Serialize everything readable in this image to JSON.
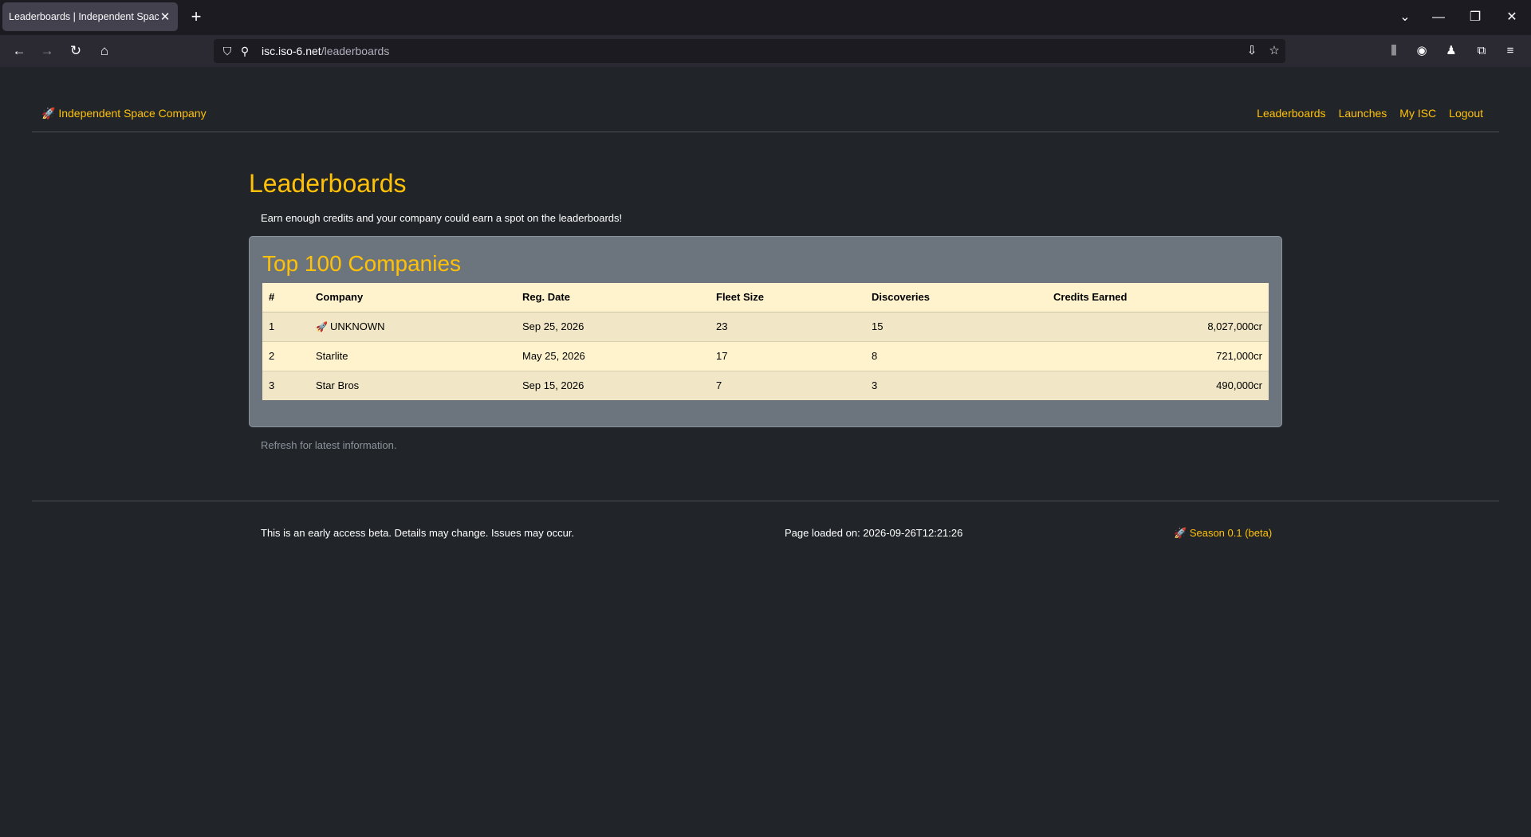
{
  "browser": {
    "tab_title": "Leaderboards | Independent Space Company",
    "url_domain": "isc.iso-6.net",
    "url_path": "/leaderboards",
    "icons": [
      "back-icon",
      "forward-icon",
      "reload-icon",
      "home-icon",
      "shield-icon",
      "permissions-icon",
      "download-icon",
      "bookmark-star-icon",
      "library-icon",
      "account-icon",
      "extension-icon",
      "puzzle-icon",
      "menu-icon"
    ]
  },
  "header": {
    "brand": "Independent Space Company",
    "nav": [
      "Leaderboards",
      "Launches",
      "My ISC",
      "Logout"
    ]
  },
  "main": {
    "title": "Leaderboards",
    "intro": "Earn enough credits and your company could earn a spot on the leaderboards!",
    "panel_title": "Top 100 Companies",
    "columns": [
      "#",
      "Company",
      "Reg. Date",
      "Fleet Size",
      "Discoveries",
      "Credits Earned"
    ],
    "rows": [
      {
        "rank": "1",
        "company": "UNKNOWN",
        "reg_date": "Sep 25, 2026",
        "fleet": "23",
        "discoveries": "15",
        "credits": "8,027,000cr"
      },
      {
        "rank": "2",
        "company": "Starlite",
        "reg_date": "May 25, 2026",
        "fleet": "17",
        "discoveries": "8",
        "credits": "721,000cr"
      },
      {
        "rank": "3",
        "company": "Star Bros",
        "reg_date": "Sep 15, 2026",
        "fleet": "7",
        "discoveries": "3",
        "credits": "490,000cr"
      }
    ],
    "refresh_note": "Refresh for latest information."
  },
  "footer": {
    "beta_note": "This is an early access beta. Details may change. Issues may occur.",
    "page_loaded": "Page loaded on: 2026-09-26T12:21:26",
    "season": "Season 0.1 (beta)"
  },
  "colors": {
    "accent": "#ffc107",
    "background": "#212529",
    "panel": "#6c757d"
  }
}
